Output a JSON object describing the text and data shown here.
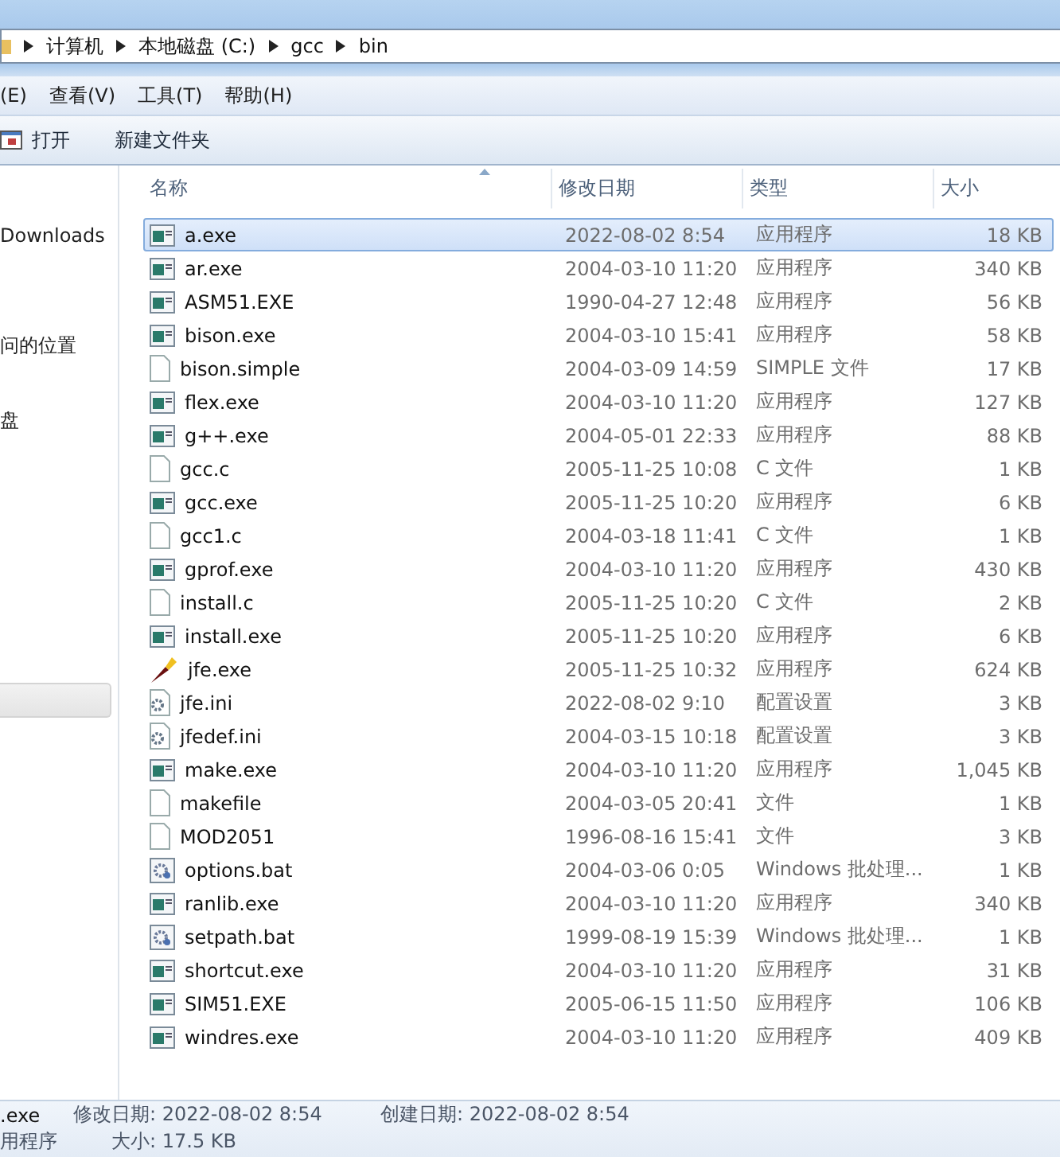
{
  "address_bar": {
    "crumbs": [
      "计算机",
      "本地磁盘 (C:)",
      "gcc",
      "bin"
    ]
  },
  "menu_bar": {
    "items": [
      "(E)",
      "查看(V)",
      "工具(T)",
      "帮助(H)"
    ]
  },
  "toolbar": {
    "buttons": [
      {
        "kind": "open",
        "label": "打开"
      },
      {
        "kind": "plain",
        "label": "新建文件夹"
      }
    ]
  },
  "sidebar": {
    "items": [
      {
        "label": "Downloads",
        "selected": false
      },
      {
        "label": "问的位置",
        "selected": false
      },
      {
        "label": "盘",
        "selected": false
      },
      {
        "selected": true
      }
    ]
  },
  "table": {
    "columns": [
      "名称",
      "修改日期",
      "类型",
      "大小"
    ],
    "rows": [
      {
        "kind": "exe",
        "name": "a.exe",
        "date": "2022-08-02 8:54",
        "type": "应用程序",
        "size": "18 KB",
        "selected": true
      },
      {
        "kind": "exe",
        "name": "ar.exe",
        "date": "2004-03-10 11:20",
        "type": "应用程序",
        "size": "340 KB",
        "selected": false
      },
      {
        "kind": "exe",
        "name": "ASM51.EXE",
        "date": "1990-04-27 12:48",
        "type": "应用程序",
        "size": "56 KB",
        "selected": false
      },
      {
        "kind": "exe",
        "name": "bison.exe",
        "date": "2004-03-10 15:41",
        "type": "应用程序",
        "size": "58 KB",
        "selected": false
      },
      {
        "kind": "file",
        "name": "bison.simple",
        "date": "2004-03-09 14:59",
        "type": "SIMPLE 文件",
        "size": "17 KB",
        "selected": false
      },
      {
        "kind": "exe",
        "name": "flex.exe",
        "date": "2004-03-10 11:20",
        "type": "应用程序",
        "size": "127 KB",
        "selected": false
      },
      {
        "kind": "exe",
        "name": "g++.exe",
        "date": "2004-05-01 22:33",
        "type": "应用程序",
        "size": "88 KB",
        "selected": false
      },
      {
        "kind": "file",
        "name": "gcc.c",
        "date": "2005-11-25 10:08",
        "type": "C 文件",
        "size": "1 KB",
        "selected": false
      },
      {
        "kind": "exe",
        "name": "gcc.exe",
        "date": "2005-11-25 10:20",
        "type": "应用程序",
        "size": "6 KB",
        "selected": false
      },
      {
        "kind": "file",
        "name": "gcc1.c",
        "date": "2004-03-18 11:41",
        "type": "C 文件",
        "size": "1 KB",
        "selected": false
      },
      {
        "kind": "exe",
        "name": "gprof.exe",
        "date": "2004-03-10 11:20",
        "type": "应用程序",
        "size": "430 KB",
        "selected": false
      },
      {
        "kind": "file",
        "name": "install.c",
        "date": "2005-11-25 10:20",
        "type": "C 文件",
        "size": "2 KB",
        "selected": false
      },
      {
        "kind": "exe",
        "name": "install.exe",
        "date": "2005-11-25 10:20",
        "type": "应用程序",
        "size": "6 KB",
        "selected": false
      },
      {
        "kind": "brush",
        "name": "jfe.exe",
        "date": "2005-11-25 10:32",
        "type": "应用程序",
        "size": "624 KB",
        "selected": false
      },
      {
        "kind": "ini",
        "name": "jfe.ini",
        "date": "2022-08-02 9:10",
        "type": "配置设置",
        "size": "3 KB",
        "selected": false
      },
      {
        "kind": "ini",
        "name": "jfedef.ini",
        "date": "2004-03-15 10:18",
        "type": "配置设置",
        "size": "3 KB",
        "selected": false
      },
      {
        "kind": "exe",
        "name": "make.exe",
        "date": "2004-03-10 11:20",
        "type": "应用程序",
        "size": "1,045 KB",
        "selected": false
      },
      {
        "kind": "file",
        "name": "makefile",
        "date": "2004-03-05 20:41",
        "type": "文件",
        "size": "1 KB",
        "selected": false
      },
      {
        "kind": "file",
        "name": "MOD2051",
        "date": "1996-08-16 15:41",
        "type": "文件",
        "size": "3 KB",
        "selected": false
      },
      {
        "kind": "bat",
        "name": "options.bat",
        "date": "2004-03-06 0:05",
        "type": "Windows 批处理...",
        "size": "1 KB",
        "selected": false
      },
      {
        "kind": "exe",
        "name": "ranlib.exe",
        "date": "2004-03-10 11:20",
        "type": "应用程序",
        "size": "340 KB",
        "selected": false
      },
      {
        "kind": "bat",
        "name": "setpath.bat",
        "date": "1999-08-19 15:39",
        "type": "Windows 批处理...",
        "size": "1 KB",
        "selected": false
      },
      {
        "kind": "exe",
        "name": "shortcut.exe",
        "date": "2004-03-10 11:20",
        "type": "应用程序",
        "size": "31 KB",
        "selected": false
      },
      {
        "kind": "exe",
        "name": "SIM51.EXE",
        "date": "2005-06-15 11:50",
        "type": "应用程序",
        "size": "106 KB",
        "selected": false
      },
      {
        "kind": "exe",
        "name": "windres.exe",
        "date": "2004-03-10 11:20",
        "type": "应用程序",
        "size": "409 KB",
        "selected": false
      }
    ]
  },
  "status_bar": {
    "lines": [
      [
        ".exe",
        "修改日期: 2022-08-02 8:54",
        "创建日期: 2022-08-02 8:54"
      ],
      [
        "用程序",
        "大小: 17.5 KB"
      ]
    ]
  }
}
